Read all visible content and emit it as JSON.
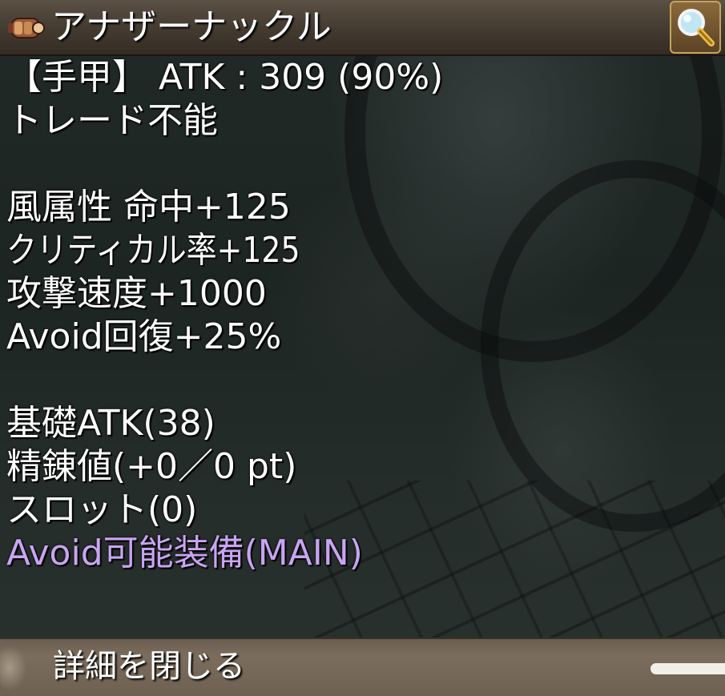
{
  "item": {
    "name": "アナザーナックル",
    "icon": "knuckle-icon"
  },
  "header": {
    "zoom_icon": "magnifier-icon"
  },
  "stats": {
    "line_type": "【手甲】 ATK : 309 (90%)",
    "line_trade": "トレード不能",
    "line_wind": "風属性 命中+125",
    "line_crit": "クリティカル率+125",
    "line_aspd": "攻撃速度+1000",
    "line_avoid": "Avoid回復+25%",
    "line_base": "基礎ATK(38)",
    "line_refine": "精錬値(+0／0 pt)",
    "line_slot": "スロット(0)",
    "line_equip": "Avoid可能装備(MAIN)"
  },
  "footer": {
    "close_label": "詳細を閉じる"
  },
  "colors": {
    "highlight": "#c9a4f2",
    "header_bg": "#433a30",
    "footer_bg": "#7b6d5d"
  }
}
